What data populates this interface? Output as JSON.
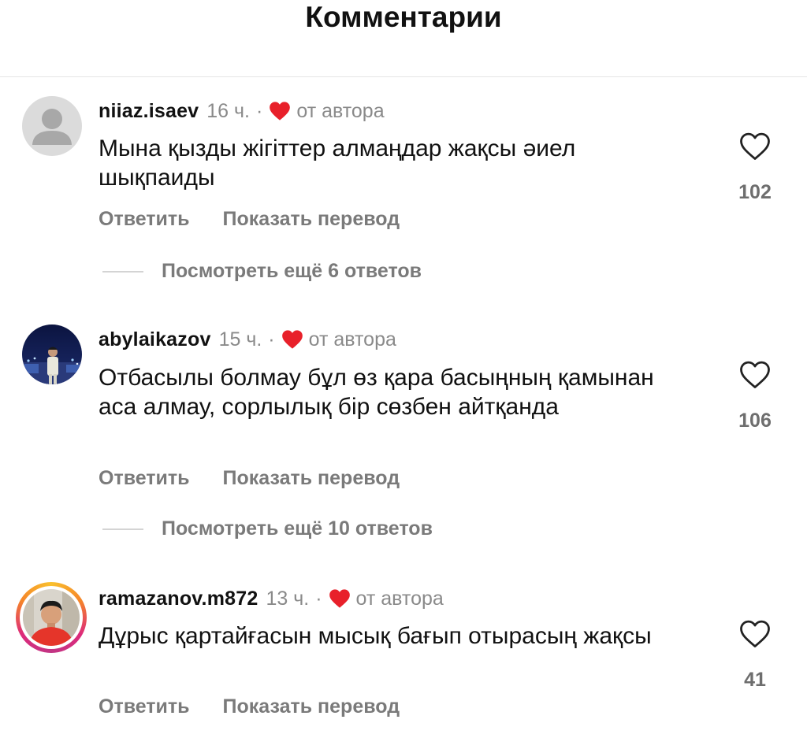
{
  "header": {
    "title": "Комментарии"
  },
  "colors": {
    "heart_red": "#e8202a",
    "muted": "#8a8a8a"
  },
  "comments": [
    {
      "username": "niiaz.isaev",
      "time": "16 ч.",
      "separator": "·",
      "by_author": "от автора",
      "text": "Мына қызды жігіттер алмаңдар жақсы әиел шықпаиды",
      "reply_label": "Ответить",
      "translate_label": "Показать перевод",
      "view_replies": "Посмотреть ещё 6 ответов",
      "likes": "102",
      "avatar": "default-avatar-icon"
    },
    {
      "username": "abylaikazov",
      "time": "15 ч.",
      "separator": "·",
      "by_author": "от автора",
      "text": "Отбасылы болмау бұл өз қара басыңның қамынан аса алмау, сорлылық бір сөзбен айтқанда",
      "reply_label": "Ответить",
      "translate_label": "Показать перевод",
      "view_replies": "Посмотреть ещё 10 ответов",
      "likes": "106",
      "avatar": "user-photo"
    },
    {
      "username": "ramazanov.m872",
      "time": "13 ч.",
      "separator": "·",
      "by_author": "от автора",
      "text": "Дұрыс қартайғасын мысық бағып отырасың жақсы",
      "reply_label": "Ответить",
      "translate_label": "Показать перевод",
      "likes": "41",
      "avatar": "user-photo-story-ring"
    }
  ]
}
